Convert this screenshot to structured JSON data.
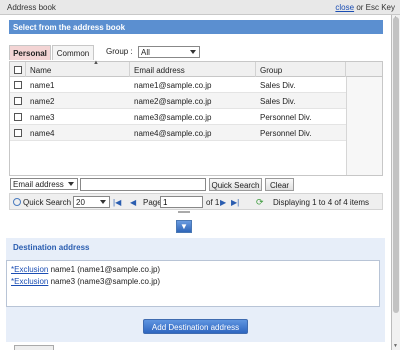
{
  "window": {
    "title": "Address book",
    "close_label": "close",
    "close_suffix": " or Esc Key"
  },
  "section_header": "Select from the address book",
  "tabs": [
    {
      "label": "Personal",
      "active": true
    },
    {
      "label": "Common",
      "active": false
    }
  ],
  "group_filter": {
    "label": "Group :",
    "value": "All"
  },
  "table": {
    "headers": [
      "Name",
      "Email address",
      "Group"
    ],
    "rows": [
      {
        "name": "name1",
        "email": "name1@sample.co.jp",
        "group": "Sales Div."
      },
      {
        "name": "name2",
        "email": "name2@sample.co.jp",
        "group": "Sales Div."
      },
      {
        "name": "name3",
        "email": "name3@sample.co.jp",
        "group": "Personnel Div."
      },
      {
        "name": "name4",
        "email": "name4@sample.co.jp",
        "group": "Personnel Div."
      }
    ]
  },
  "search": {
    "field_select": "Email address",
    "query": "",
    "quick_search_label": "Quick Search",
    "clear_label": "Clear"
  },
  "pager": {
    "quick_search_label": "Quick Search",
    "per_page": "20",
    "page_label": "Page",
    "current_page": "1",
    "of_label": "of 1",
    "display_text": "Displaying 1 to 4 of 4 items"
  },
  "destination": {
    "title": "Destination address",
    "items": [
      {
        "link": "*Exclusion",
        "text": " name1 (name1@sample.co.jp)"
      },
      {
        "link": "*Exclusion",
        "text": " name3 (name3@sample.co.jp)"
      }
    ],
    "add_button_label": "Add Destination address"
  },
  "colors": {
    "header_blue": "#5b8fd0",
    "active_tab": "#f3d4d4",
    "link": "#1a4db3"
  }
}
